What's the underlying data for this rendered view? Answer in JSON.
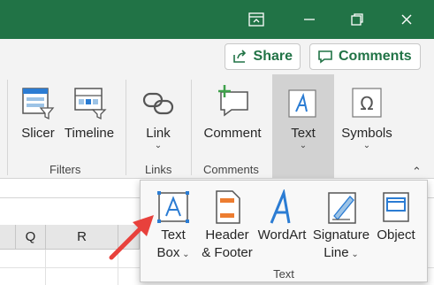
{
  "window": {
    "buttons": [
      {
        "name": "ribbon-display-options",
        "icon": "ribbon-display-icon"
      },
      {
        "name": "minimize",
        "icon": "minimize-icon"
      },
      {
        "name": "restore",
        "icon": "restore-icon"
      },
      {
        "name": "close",
        "icon": "close-icon"
      }
    ]
  },
  "header": {
    "share_label": "Share",
    "comments_label": "Comments"
  },
  "ribbon": {
    "slicer_label": "Slicer",
    "timeline_label": "Timeline",
    "link_label": "Link",
    "comment_label": "Comment",
    "text_label": "Text",
    "symbols_label": "Symbols",
    "groups": {
      "filters": "Filters",
      "links": "Links",
      "comments": "Comments"
    }
  },
  "sheet": {
    "columns": [
      "Q",
      "R"
    ]
  },
  "text_menu": {
    "items": {
      "text_box": [
        "Text",
        "Box"
      ],
      "header_footer": [
        "Header",
        "& Footer"
      ],
      "wordart": "WordArt",
      "signature_line": [
        "Signature",
        "Line"
      ],
      "object": "Object"
    },
    "group_label": "Text"
  },
  "colors": {
    "title_bar": "#217346",
    "accent": "#217346",
    "annotation_arrow": "#e8413c",
    "icon_blue": "#2b7cd3",
    "icon_orange": "#ed7d31"
  }
}
